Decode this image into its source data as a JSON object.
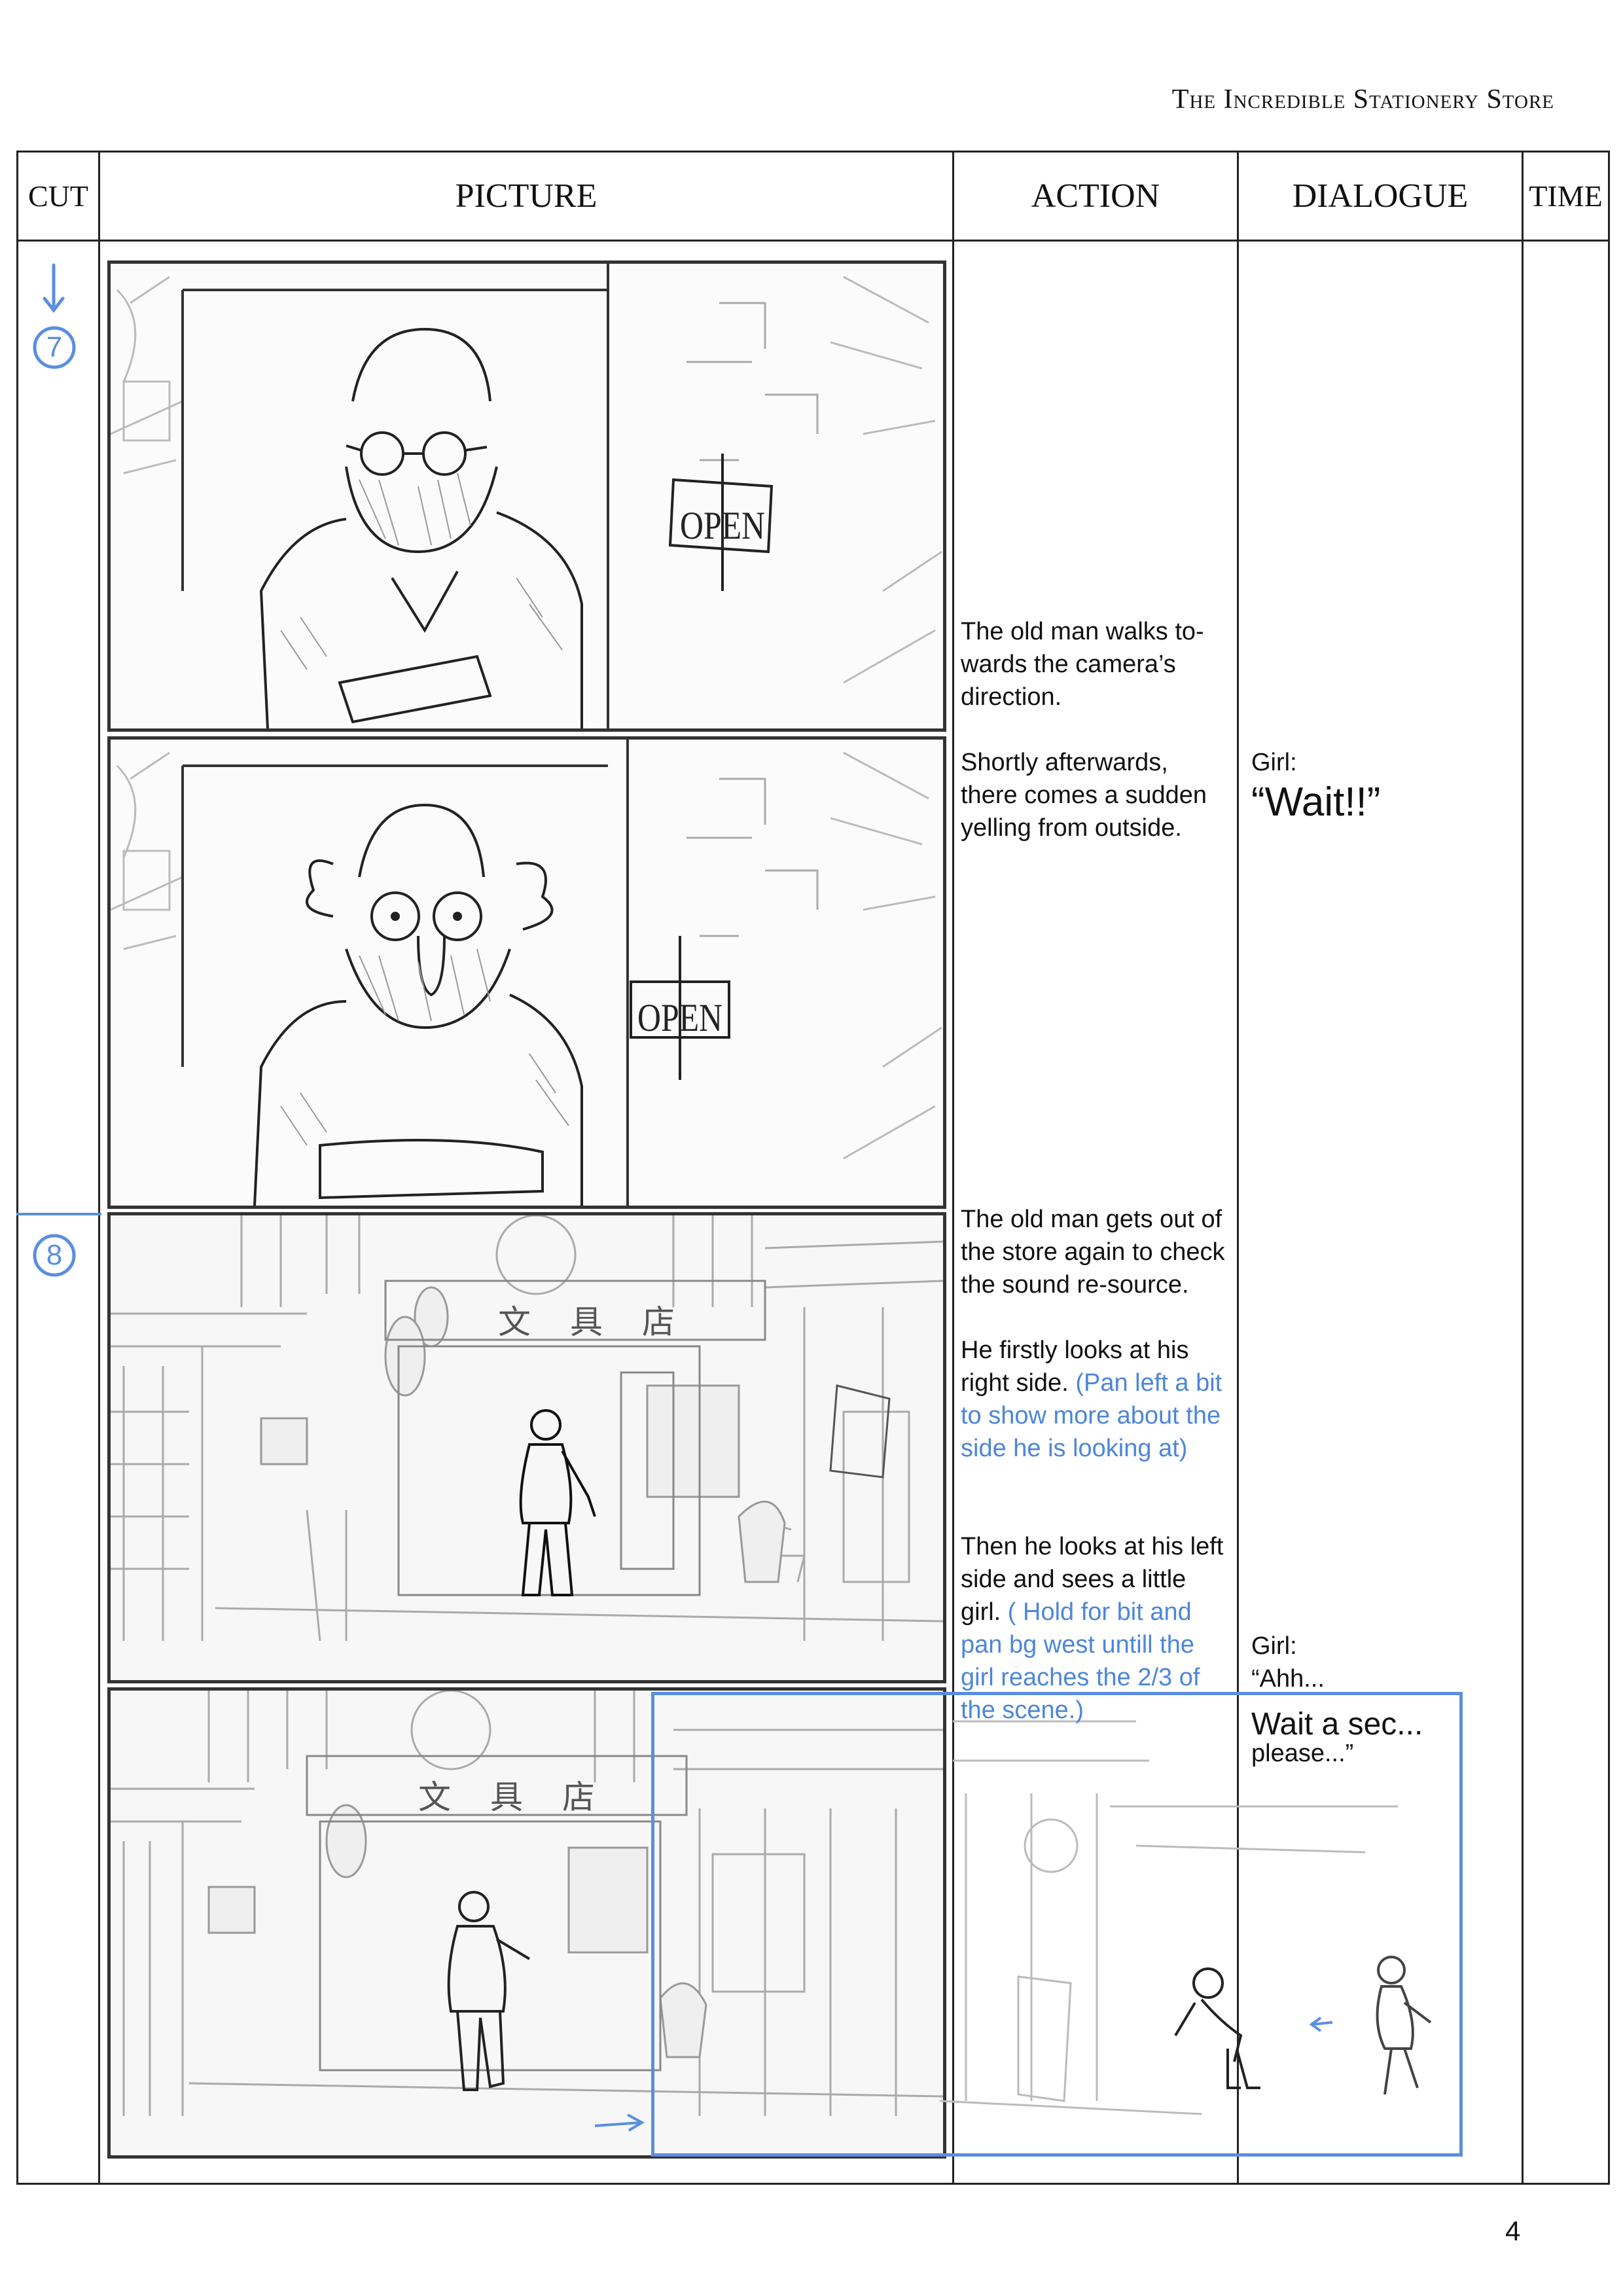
{
  "document": {
    "title": "The Incredible Stationery Store",
    "page_number": "4"
  },
  "columns": {
    "cut": "CUT",
    "picture": "PICTURE",
    "action": "ACTION",
    "dialogue": "DIALOGUE",
    "time": "TIME"
  },
  "cuts": [
    {
      "number": "7"
    },
    {
      "number": "8"
    }
  ],
  "panels": {
    "sign_text": "OPEN",
    "shop_sign_chars": [
      "文",
      "具",
      "店"
    ]
  },
  "actions": {
    "walks": "The old man walks to-wards the camera’s direction.",
    "yelling": "Shortly afterwards, there comes a sudden yelling from outside.",
    "gets_out": "The old man gets out of the store again to check the sound re-source.",
    "looks_right": "He firstly looks at his right side.",
    "looks_right_note": "(Pan left a bit to show more about the side he is looking at)",
    "looks_left": "Then he looks at his left side and sees a little girl.",
    "looks_left_note": "( Hold for bit and pan bg west untill the girl reaches the 2/3 of the scene.)"
  },
  "dialogues": {
    "d1_speaker": "Girl:",
    "d1_line": "“Wait!!”",
    "d2_speaker": "Girl:",
    "d2_line1": "“Ahh...",
    "d2_line2": "Wait a sec...",
    "d2_line3": "please...”"
  },
  "colors": {
    "note_blue": "#4d86d8",
    "frame_blue": "#5b8ee0",
    "line": "#222222"
  }
}
